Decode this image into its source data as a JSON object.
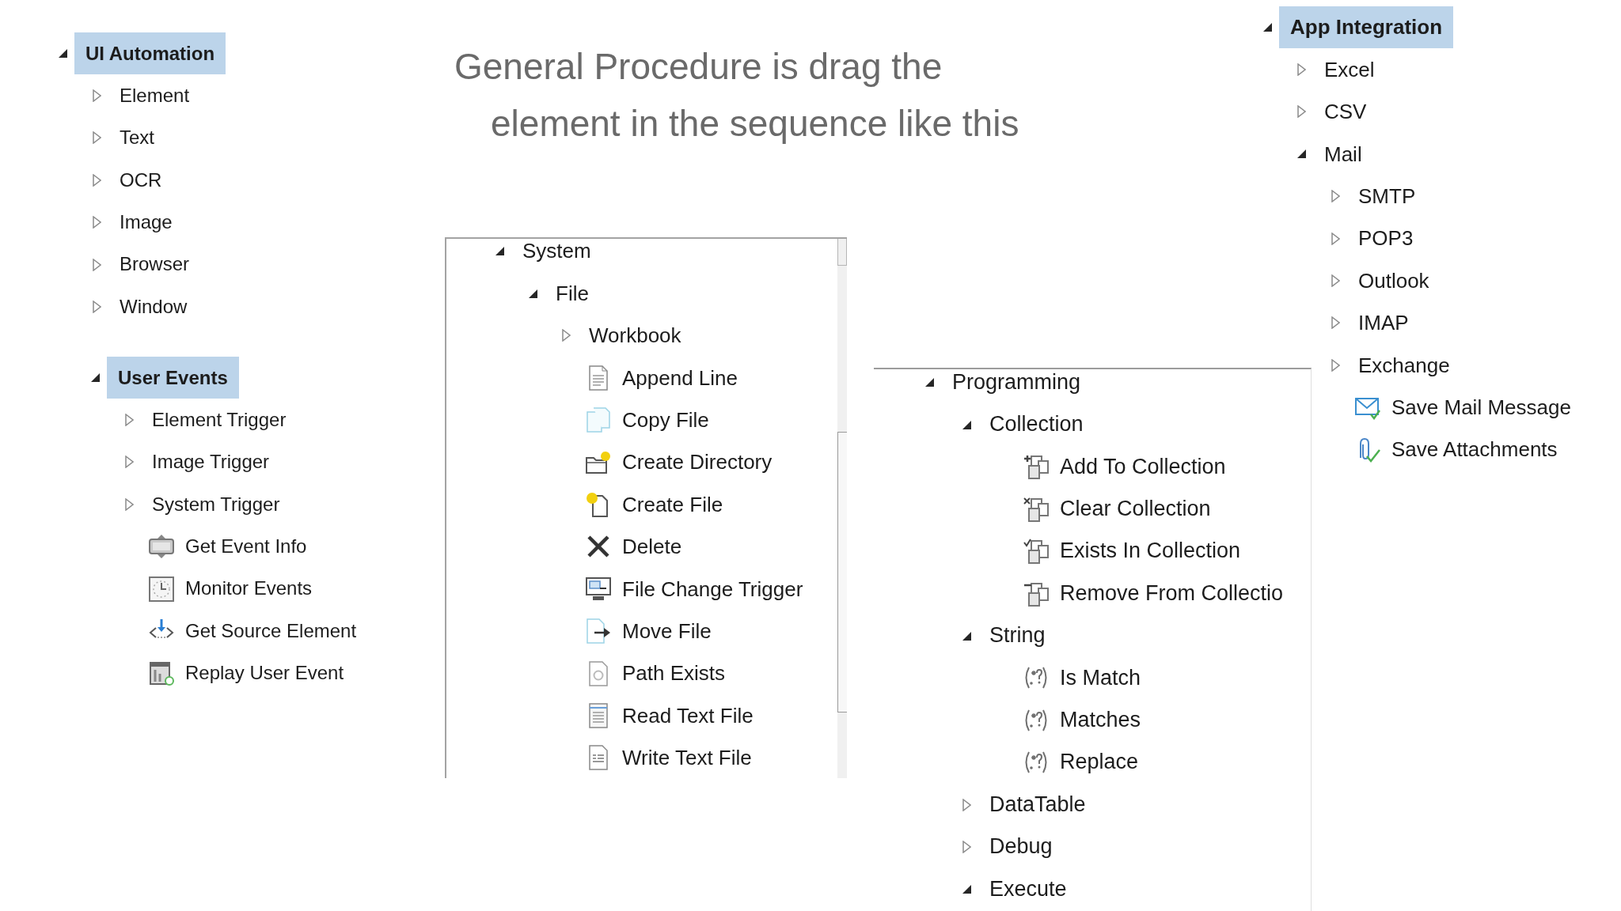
{
  "title": "General Procedure is drag the element in the sequence like this",
  "panels": [
    {
      "items": [
        {
          "kind": "category",
          "label": "UI Automation",
          "expanded": true,
          "selected": true,
          "children": [
            {
              "kind": "category",
              "label": "Element",
              "expanded": false,
              "selected": false
            },
            {
              "kind": "category",
              "label": "Text",
              "expanded": false,
              "selected": false
            },
            {
              "kind": "category",
              "label": "OCR",
              "expanded": false,
              "selected": false
            },
            {
              "kind": "category",
              "label": "Image",
              "expanded": false,
              "selected": false
            },
            {
              "kind": "category",
              "label": "Browser",
              "expanded": false,
              "selected": false
            },
            {
              "kind": "category",
              "label": "Window",
              "expanded": false,
              "selected": false
            }
          ]
        }
      ]
    },
    {
      "items": [
        {
          "kind": "category",
          "label": "User Events",
          "expanded": true,
          "selected": true,
          "children": [
            {
              "kind": "category",
              "label": "Element Trigger",
              "expanded": false,
              "selected": false
            },
            {
              "kind": "category",
              "label": "Image Trigger",
              "expanded": false,
              "selected": false
            },
            {
              "kind": "category",
              "label": "System Trigger",
              "expanded": false,
              "selected": false
            },
            {
              "kind": "activity",
              "label": "Get Event Info",
              "selected": false
            },
            {
              "kind": "activity",
              "label": "Monitor Events",
              "selected": false
            },
            {
              "kind": "activity",
              "label": "Get Source Element",
              "selected": false
            },
            {
              "kind": "activity",
              "label": "Replay User Event",
              "selected": false
            }
          ]
        }
      ]
    },
    {
      "items": [
        {
          "kind": "category",
          "label": "System",
          "expanded": true,
          "selected": false,
          "children": [
            {
              "kind": "category",
              "label": "File",
              "expanded": true,
              "selected": false,
              "children": [
                {
                  "kind": "category",
                  "label": "Workbook",
                  "expanded": false,
                  "selected": false
                },
                {
                  "kind": "activity",
                  "label": "Append Line",
                  "selected": false
                },
                {
                  "kind": "activity",
                  "label": "Copy File",
                  "selected": false
                },
                {
                  "kind": "activity",
                  "label": "Create Directory",
                  "selected": false
                },
                {
                  "kind": "activity",
                  "label": "Create File",
                  "selected": false
                },
                {
                  "kind": "activity",
                  "label": "Delete",
                  "selected": false
                },
                {
                  "kind": "activity",
                  "label": "File Change Trigger",
                  "selected": false
                },
                {
                  "kind": "activity",
                  "label": "Move File",
                  "selected": false
                },
                {
                  "kind": "activity",
                  "label": "Path Exists",
                  "selected": false
                },
                {
                  "kind": "activity",
                  "label": "Read Text File",
                  "selected": false
                },
                {
                  "kind": "activity",
                  "label": "Write Text File",
                  "selected": false
                }
              ]
            }
          ]
        }
      ]
    },
    {
      "items": [
        {
          "kind": "category",
          "label": "Programming",
          "expanded": true,
          "selected": false,
          "children": [
            {
              "kind": "category",
              "label": "Collection",
              "expanded": true,
              "selected": false,
              "children": [
                {
                  "kind": "activity",
                  "label": "Add To Collection",
                  "selected": false
                },
                {
                  "kind": "activity",
                  "label": "Clear Collection",
                  "selected": false
                },
                {
                  "kind": "activity",
                  "label": "Exists In Collection",
                  "selected": false
                },
                {
                  "kind": "activity",
                  "label": "Remove From Collectio",
                  "selected": false
                }
              ]
            },
            {
              "kind": "category",
              "label": "String",
              "expanded": true,
              "selected": false,
              "children": [
                {
                  "kind": "activity",
                  "label": "Is Match",
                  "selected": false
                },
                {
                  "kind": "activity",
                  "label": "Matches",
                  "selected": false
                },
                {
                  "kind": "activity",
                  "label": "Replace",
                  "selected": false
                }
              ]
            },
            {
              "kind": "category",
              "label": "DataTable",
              "expanded": false,
              "selected": false
            },
            {
              "kind": "category",
              "label": "Debug",
              "expanded": false,
              "selected": false
            },
            {
              "kind": "category",
              "label": "Execute",
              "expanded": true,
              "selected": false
            }
          ]
        }
      ]
    },
    {
      "items": [
        {
          "kind": "category",
          "label": "App Integration",
          "expanded": true,
          "selected": true,
          "children": [
            {
              "kind": "category",
              "label": "Excel",
              "expanded": false,
              "selected": false
            },
            {
              "kind": "category",
              "label": "CSV",
              "expanded": false,
              "selected": false
            },
            {
              "kind": "category",
              "label": "Mail",
              "expanded": true,
              "selected": false,
              "children": [
                {
                  "kind": "category",
                  "label": "SMTP",
                  "expanded": false,
                  "selected": false
                },
                {
                  "kind": "category",
                  "label": "POP3",
                  "expanded": false,
                  "selected": false
                },
                {
                  "kind": "category",
                  "label": "Outlook",
                  "expanded": false,
                  "selected": false
                },
                {
                  "kind": "category",
                  "label": "IMAP",
                  "expanded": false,
                  "selected": false
                },
                {
                  "kind": "category",
                  "label": "Exchange",
                  "expanded": false,
                  "selected": false
                },
                {
                  "kind": "activity",
                  "label": "Save Mail Message",
                  "selected": false
                },
                {
                  "kind": "activity",
                  "label": "Save Attachments",
                  "selected": false
                }
              ]
            }
          ]
        }
      ]
    }
  ]
}
